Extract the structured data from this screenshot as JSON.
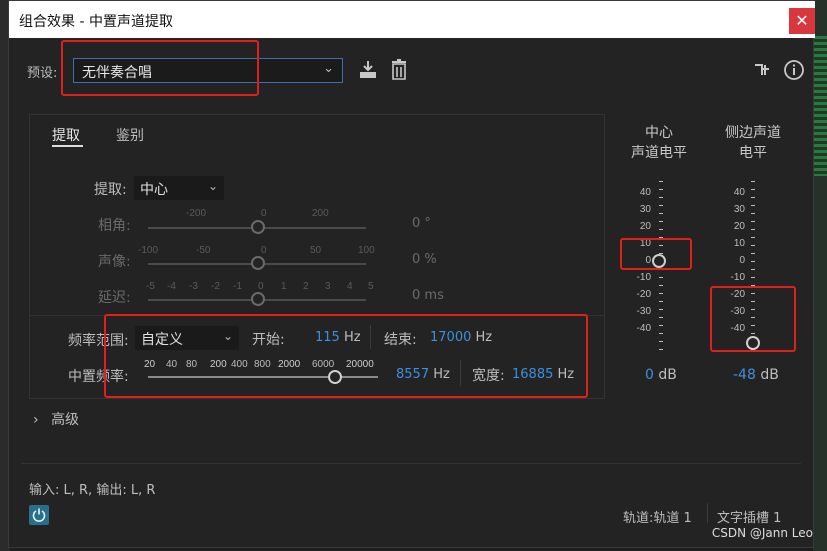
{
  "window": {
    "title": "组合效果 - 中置声道提取",
    "close_glyph": "✕"
  },
  "preset": {
    "label": "预设:",
    "value": "无伴奏合唱"
  },
  "icons": [
    "save-preset-icon",
    "delete-preset-icon",
    "routing-icon",
    "info-icon"
  ],
  "tabs": [
    {
      "label": "提取",
      "active": true
    },
    {
      "label": "鉴别",
      "active": false
    }
  ],
  "extract": {
    "label": "提取:",
    "value": "中心"
  },
  "phase": {
    "label": "相角:",
    "scale": [
      "-200",
      "0",
      "200"
    ],
    "value": "0",
    "unit": "°"
  },
  "pan": {
    "label": "声像:",
    "scale": [
      "-100",
      "-50",
      "0",
      "50",
      "100"
    ],
    "value": "0",
    "unit": "%"
  },
  "delay": {
    "label": "延迟:",
    "scale": [
      "-5",
      "-4",
      "-3",
      "-2",
      "-1",
      "0",
      "1",
      "2",
      "3",
      "4",
      "5"
    ],
    "value": "0",
    "unit": "ms"
  },
  "freq_range": {
    "label": "频率范围:",
    "value": "自定义",
    "start_label": "开始:",
    "start_value": "115",
    "start_unit": "Hz",
    "end_label": "结束:",
    "end_value": "17000",
    "end_unit": "Hz"
  },
  "center_freq": {
    "label": "中置频率:",
    "scale": [
      "20",
      "40",
      "80",
      "200",
      "400",
      "800",
      "2000",
      "6000",
      "20000"
    ],
    "value": "8557",
    "unit": "Hz",
    "width_label": "宽度:",
    "width_value": "16885",
    "width_unit": "Hz"
  },
  "meters": {
    "center": {
      "title_line1": "中心",
      "title_line2": "声道电平",
      "value": "0",
      "unit": "dB",
      "level_db": 0
    },
    "side": {
      "title_line1": "侧边声道",
      "title_line2": "电平",
      "value": "-48",
      "unit": "dB",
      "level_db": -48
    },
    "ticks": [
      "40",
      "30",
      "20",
      "10",
      "0",
      "-10",
      "-20",
      "-30",
      "-40"
    ]
  },
  "advanced": {
    "label": "高级",
    "chevron": "›"
  },
  "footer": {
    "io": "输入: L, R,  输出: L, R",
    "track": "轨道:轨道 1",
    "slot": "文字插槽 1",
    "watermark": "CSDN @Jann Leo"
  },
  "colors": {
    "accent": "#3d8fe0",
    "annotation": "#e0201a",
    "close": "#d9363e"
  }
}
